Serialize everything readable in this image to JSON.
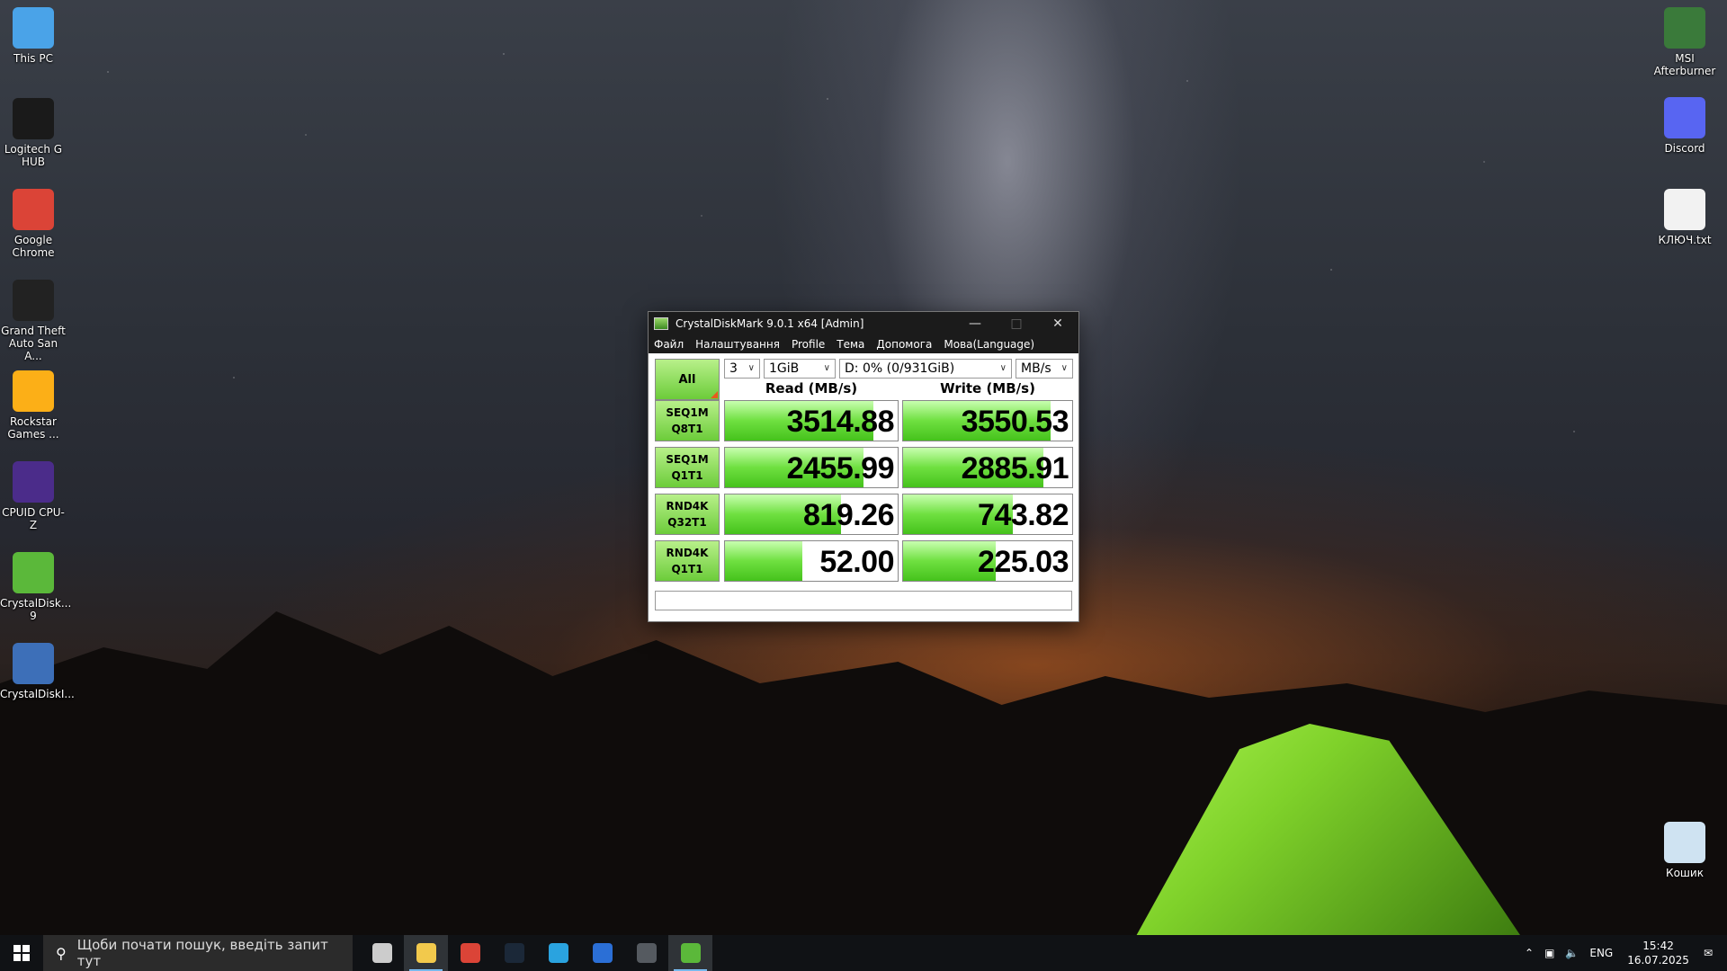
{
  "desktop": {
    "left_icons": [
      {
        "label": "This PC",
        "icon": "computer-icon",
        "color": "#4aa3e8"
      },
      {
        "label": "Logitech G HUB",
        "icon": "logitech-g-icon",
        "color": "#1a1a1a"
      },
      {
        "label": "Google Chrome",
        "icon": "chrome-icon",
        "color": "#db4437"
      },
      {
        "label": "Grand Theft Auto San A...",
        "icon": "gta-sa-icon",
        "color": "#222222"
      },
      {
        "label": "Rockstar Games ...",
        "icon": "rockstar-icon",
        "color": "#fcaf17"
      },
      {
        "label": "CPUID CPU-Z",
        "icon": "cpuz-icon",
        "color": "#4b2c8a"
      },
      {
        "label": "CrystalDisk... 9",
        "icon": "crystaldisk-icon",
        "color": "#5bb83a"
      },
      {
        "label": "CrystalDiskI...",
        "icon": "crystaldiskinfo-icon",
        "color": "#3d6fb8"
      }
    ],
    "right_icons": [
      {
        "label": "MSI Afterburner",
        "icon": "msi-afterburner-icon",
        "color": "#3a7a3a"
      },
      {
        "label": "Discord",
        "icon": "discord-icon",
        "color": "#5865f2"
      },
      {
        "label": "КЛЮЧ.txt",
        "icon": "text-file-icon",
        "color": "#f2f2f2"
      },
      {
        "label": "Кошик",
        "icon": "recycle-bin-icon",
        "color": "#cfe3f2"
      }
    ]
  },
  "cdm": {
    "title": "CrystalDiskMark 9.0.1 x64 [Admin]",
    "menu": [
      "Файл",
      "Налаштування",
      "Profile",
      "Тема",
      "Допомога",
      "Мова(Language)"
    ],
    "all_label": "All",
    "count": "3",
    "size": "1GiB",
    "drive": "D: 0% (0/931GiB)",
    "unit": "MB/s",
    "read_header": "Read (MB/s)",
    "write_header": "Write (MB/s)",
    "tests": [
      {
        "l1": "SEQ1M",
        "l2": "Q8T1",
        "read": "3514.88",
        "write": "3550.53",
        "read_fill": 0.86,
        "write_fill": 0.87
      },
      {
        "l1": "SEQ1M",
        "l2": "Q1T1",
        "read": "2455.99",
        "write": "2885.91",
        "read_fill": 0.8,
        "write_fill": 0.83
      },
      {
        "l1": "RND4K",
        "l2": "Q32T1",
        "read": "819.26",
        "write": "743.82",
        "read_fill": 0.67,
        "write_fill": 0.65
      },
      {
        "l1": "RND4K",
        "l2": "Q1T1",
        "read": "52.00",
        "write": "225.03",
        "read_fill": 0.45,
        "write_fill": 0.55
      }
    ],
    "status": "",
    "accent": "#6fe040"
  },
  "taskbar": {
    "search_placeholder": "Щоби почати пошук, введіть запит тут",
    "apps": [
      {
        "icon": "task-view-icon",
        "color": "#cccccc"
      },
      {
        "icon": "file-explorer-icon",
        "color": "#f2c94c"
      },
      {
        "icon": "chrome-icon",
        "color": "#db4437"
      },
      {
        "icon": "steam-icon",
        "color": "#1b2838"
      },
      {
        "icon": "telegram-icon",
        "color": "#2aa3df"
      },
      {
        "icon": "store-icon",
        "color": "#2b6fd6"
      },
      {
        "icon": "calculator-icon",
        "color": "#555a60"
      },
      {
        "icon": "crystaldisk-icon",
        "color": "#5bb83a"
      }
    ],
    "lang": "ENG",
    "time": "15:42",
    "date": "16.07.2025"
  }
}
